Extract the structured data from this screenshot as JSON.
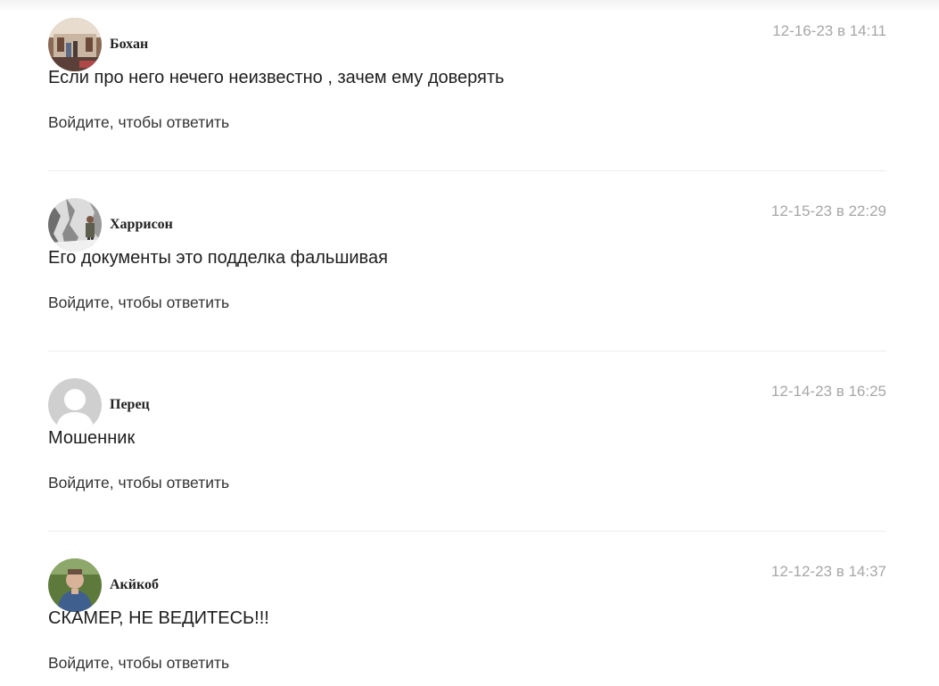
{
  "comments": [
    {
      "author": "Бохан",
      "date": "12-16-23 в 14:11",
      "text": "Если про него нечего неизвестно , зачем ему доверять",
      "reply_label": "Войдите, чтобы ответить",
      "avatar_icon": "photo-avatar-icon"
    },
    {
      "author": "Харрисон",
      "date": "12-15-23 в 22:29",
      "text": "Его документы это подделка фальшивая",
      "reply_label": "Войдите, чтобы ответить",
      "avatar_icon": "photo-avatar-icon"
    },
    {
      "author": "Перец",
      "date": "12-14-23 в 16:25",
      "text": "Мошенник",
      "reply_label": "Войдите, чтобы ответить",
      "avatar_icon": "default-user-avatar-icon"
    },
    {
      "author": "Акйкоб",
      "date": "12-12-23 в 14:37",
      "text": "СКАМЕР, НЕ ВЕДИТЕСЬ!!!",
      "reply_label": "Войдите, чтобы ответить",
      "avatar_icon": "photo-avatar-icon"
    }
  ],
  "colors": {
    "date_gray": "#a7a7a7",
    "divider": "#ececec",
    "text": "#1e1e1e"
  }
}
